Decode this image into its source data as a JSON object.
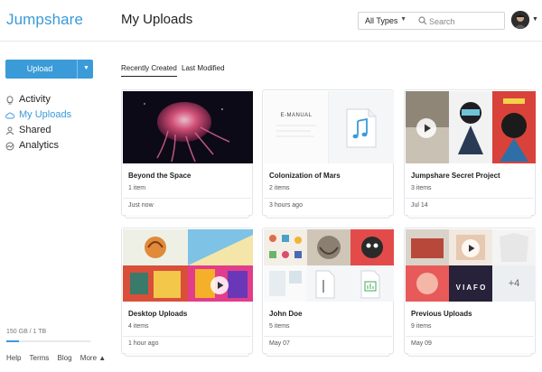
{
  "app": {
    "logo": "Jumpshare",
    "page_title": "My Uploads"
  },
  "filter": {
    "type_label": "All Types",
    "search_placeholder": "Search"
  },
  "sidebar": {
    "upload_label": "Upload",
    "items": [
      {
        "label": "Activity",
        "icon": "bulb-icon",
        "active": false
      },
      {
        "label": "My Uploads",
        "icon": "cloud-icon",
        "active": true
      },
      {
        "label": "Shared",
        "icon": "users-icon",
        "active": false
      },
      {
        "label": "Analytics",
        "icon": "chart-icon",
        "active": false
      }
    ],
    "storage": {
      "label": "150 GB / 1 TB",
      "used_fraction": 0.15
    },
    "footer": [
      "Help",
      "Terms",
      "Blog",
      "More ▲"
    ]
  },
  "tabs": [
    {
      "label": "Recently Created",
      "active": true
    },
    {
      "label": "Last Modified",
      "active": false
    }
  ],
  "cards": [
    {
      "title": "Beyond the Space",
      "count": "1 item",
      "time": "Just now"
    },
    {
      "title": "Colonization of Mars",
      "count": "2 items",
      "time": "3 hours ago",
      "doc_label": "E-MANUAL"
    },
    {
      "title": "Jumpshare Secret Project",
      "count": "3 items",
      "time": "Jul 14"
    },
    {
      "title": "Desktop Uploads",
      "count": "4 items",
      "time": "1 hour ago"
    },
    {
      "title": "John Doe",
      "count": "5 items",
      "time": "May 07"
    },
    {
      "title": "Previous Uploads",
      "count": "9 items",
      "time": "May 09",
      "more_label": "+4",
      "brand_text": "V I A F O"
    }
  ],
  "colors": {
    "accent": "#3b9bd9",
    "text": "#222222",
    "border": "#e2e6ea"
  }
}
